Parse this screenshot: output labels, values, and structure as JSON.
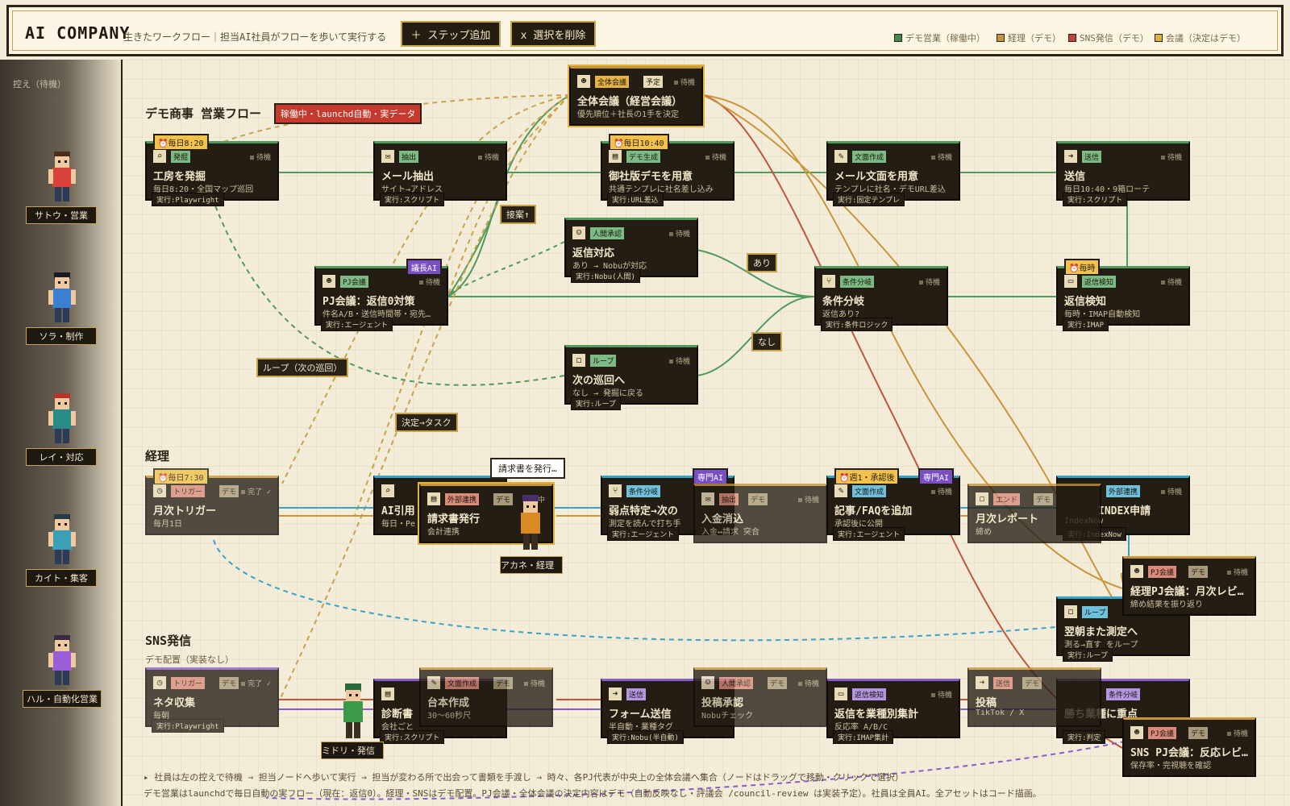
{
  "header": {
    "logo": "AI COMPANY",
    "subtitle": "生きたワークフロー｜担当AI社員がフローを歩いて実行する",
    "add_step": "＋ ステップ追加",
    "delete_sel": "x 選択を削除",
    "legend": [
      {
        "label": "デモ営業（稼働中）",
        "color": "#3f8a4d"
      },
      {
        "label": "経理（デモ）",
        "color": "#c9953a"
      },
      {
        "label": "SNS発信（デモ）",
        "color": "#c0463a"
      },
      {
        "label": "会議（決定はデモ）",
        "color": "#e0b03a"
      }
    ]
  },
  "sidebar": {
    "title": "控え（待機）",
    "employees": [
      {
        "label": "サトウ・営業",
        "hair": "#4a2e1a",
        "shirt": "#d9423a"
      },
      {
        "label": "ソラ・制作",
        "hair": "#1a1a24",
        "shirt": "#3a7fd0"
      },
      {
        "label": "レイ・対応",
        "hair": "#b8332c",
        "shirt": "#2a8a88"
      },
      {
        "label": "カイト・集客",
        "hair": "#243a4a",
        "shirt": "#3aa0b8"
      },
      {
        "label": "ハル・自動化営業",
        "hair": "#3a2a44",
        "shirt": "#9a5fd6"
      }
    ]
  },
  "sections": {
    "sales": {
      "title": "デモ商事 営業フロー",
      "badge": "稼働中・launchd自動・実データ"
    },
    "acct": {
      "title": "経理"
    },
    "sns": {
      "title": "SNS発信",
      "sub": "デモ配置（実装なし）"
    }
  },
  "nodes": {
    "meeting": {
      "tag": "全体会議",
      "tag2": "予定",
      "state": "待機",
      "title": "全体会議（経営会議）",
      "sub": "優先順位＋社長の1手を決定"
    },
    "n1": {
      "sched": "⏰毎日8:20",
      "tag": "発掘",
      "state": "待機",
      "title": "工房を発掘",
      "sub": "毎日8:20・全国マップ巡回",
      "exec": "実行:Playwright"
    },
    "n2": {
      "tag": "抽出",
      "state": "待機",
      "title": "メール抽出",
      "sub": "サイト→アドレス",
      "exec": "実行:スクリプト"
    },
    "n3": {
      "sched": "⏰毎日10:40",
      "tag": "デモ生成",
      "state": "待機",
      "title": "御社版デモを用意",
      "sub": "共通テンプレに社名差し込み",
      "exec": "実行:URL差込"
    },
    "n4": {
      "tag": "文面作成",
      "state": "待機",
      "title": "メール文面を用意",
      "sub": "テンプレに社名・デモURL差込",
      "exec": "実行:固定テンプレ"
    },
    "n5": {
      "tag": "送信",
      "state": "待機",
      "title": "送信",
      "sub": "毎日10:40・9箱ローテ",
      "exec": "実行:スクリプト"
    },
    "n6": {
      "tag": "人間承認",
      "state": "待機",
      "title": "返信対応",
      "sub": "あり → Nobuが対応",
      "exec": "実行:Nobu(人間)"
    },
    "n7": {
      "ai": "議長AI",
      "tag": "PJ会議",
      "state": "待機",
      "title": "PJ会議：返信0対策",
      "sub": "件名A/B・送信時間帯・宛先…",
      "exec": "実行:エージェント"
    },
    "n8": {
      "tag": "条件分岐",
      "state": "待機",
      "title": "条件分岐",
      "sub": "返信あり?",
      "exec": "実行:条件ロジック"
    },
    "n9": {
      "sched": "⏰毎時",
      "tag": "返信検知",
      "state": "待機",
      "title": "返信検知",
      "sub": "毎時・IMAP自動検知",
      "exec": "実行:IMAP"
    },
    "n10": {
      "tag": "ループ",
      "state": "待機",
      "title": "次の巡回へ",
      "sub": "なし → 発掘に戻る",
      "exec": "実行:ループ"
    },
    "a1": {
      "sched": "⏰毎日7:30",
      "tag": "トリガー",
      "demo": "デモ",
      "state": "完了 ✓",
      "title": "月次トリガー",
      "sub": "毎月1日"
    },
    "a2": {
      "tag": "外部連携",
      "demo": "デモ",
      "state": "中",
      "title": "請求書発行",
      "sub": "会計連携"
    },
    "a2b": {
      "title": "AI引用",
      "sub": "毎日・Pe"
    },
    "a3": {
      "ai": "専門AI",
      "tag": "条件分岐",
      "title": "弱点特定→次の",
      "sub": "測定を読んで打ち手",
      "exec": "実行:エージェント"
    },
    "a4": {
      "tag": "抽出",
      "demo": "デモ",
      "state": "待機",
      "title": "入金消込",
      "sub": "入金↔請求 突合"
    },
    "a5": {
      "sched": "⏰週1・承認後",
      "ai": "専門AI",
      "tag": "文面作成",
      "state": "待機",
      "title": "記事/FAQを追加",
      "sub": "承認後に公開",
      "exec": "実行:エージェント"
    },
    "a6": {
      "tag": "エンド",
      "demo": "デモ",
      "title": "月次レポート",
      "sub": "締め"
    },
    "a7": {
      "tag": "外部連携",
      "state": "待機",
      "title": "INDEX申請",
      "sub": "IndexNow",
      "exec": "実行:IndexNow"
    },
    "a8": {
      "tag": "PJ会議",
      "demo": "デモ",
      "state": "待機",
      "title": "経理PJ会議：月次レビ…",
      "sub": "締め結果を振り返り"
    },
    "a9": {
      "tag": "ループ",
      "state": "待機",
      "title": "翌朝また測定へ",
      "sub": "測る→直す をループ",
      "exec": "実行:ループ"
    },
    "s1": {
      "tag": "トリガー",
      "demo": "デモ",
      "state": "完了 ✓",
      "title": "ネタ収集",
      "sub": "毎朝",
      "exec": "実行:Playwright"
    },
    "s2": {
      "title": "診断書",
      "sub": "会社ごと",
      "exec": "実行:スクリプト"
    },
    "s3": {
      "tag": "文面作成",
      "demo": "デモ",
      "state": "待機",
      "title": "台本作成",
      "sub": "30〜60秒尺"
    },
    "s4": {
      "tag": "送信",
      "title": "フォーム送信",
      "sub": "半自動・業種タグ",
      "exec": "実行:Nobu(半自動)"
    },
    "s5": {
      "tag": "人間承認",
      "demo": "デモ",
      "state": "待機",
      "title": "投稿承認",
      "sub": "Nobuチェック"
    },
    "s6": {
      "tag": "返信検知",
      "state": "待機",
      "title": "返信を業種別集計",
      "sub": "反応率 A/B/C",
      "exec": "実行:IMAP集計"
    },
    "s7": {
      "tag": "送信",
      "demo": "デモ",
      "title": "投稿",
      "sub": "TikTok / X"
    },
    "s8": {
      "tag": "条件分岐",
      "title": "勝ち業種に重点",
      "exec": "実行:判定"
    },
    "s9": {
      "tag": "PJ会議",
      "demo": "デモ",
      "state": "待機",
      "title": "SNS PJ会議：反応レビ…",
      "sub": "保存率・完視聴を確認"
    }
  },
  "edge_labels": {
    "reply_up": "接案↑",
    "yes": "あり",
    "no": "なし",
    "loop": "ループ（次の巡回）",
    "decide": "決定→タスク"
  },
  "walker": {
    "akane": "アカネ・経理",
    "midori": "ミドリ・発信",
    "tooltip": "請求書を発行…"
  },
  "footer": {
    "line1": "▸ 社員は左の控えで待機 → 担当ノードへ歩いて実行 → 担当が変わる所で出会って書類を手渡し → 時々、各PJ代表が中央上の全体会議へ集合（ノードはドラッグで移動・クリックで選択）",
    "line2": "デモ営業はlaunchdで毎日自動の実フロー（現在：返信0）。経理・SNSはデモ配置。PJ会議・全体会議の決定内容はデモ（自動反映なし・評議会 /council-review は実装予定）。社員は全員AI。全アセットはコード描画。"
  },
  "colors": {
    "green": "#4f9a5c",
    "blue": "#38a3c9",
    "purple": "#8a5cc9",
    "orange": "#c9953a",
    "red": "#c0563a",
    "gold": "#c9a34a"
  }
}
